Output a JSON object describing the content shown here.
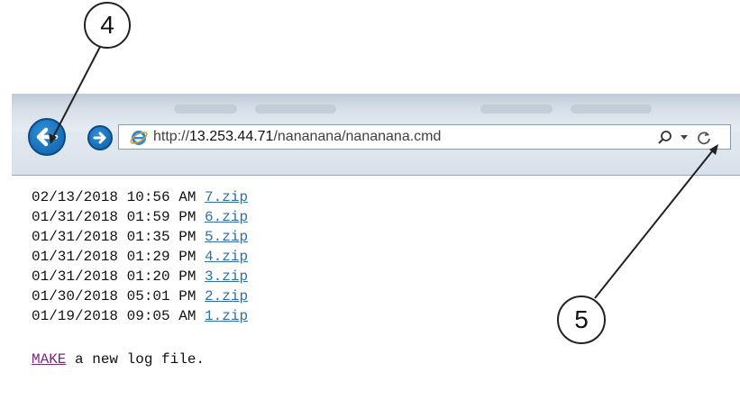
{
  "callouts": {
    "back_label": "4",
    "refresh_label": "5"
  },
  "browser": {
    "address_bar": {
      "url_prefix": "http://",
      "url_host": "13.253.44.71",
      "url_path": "/nananana/nananana.cmd"
    },
    "icons": {
      "back": "back-arrow-icon",
      "forward": "forward-arrow-icon",
      "site": "internet-explorer-icon",
      "search": "search-icon",
      "dropdown": "chevron-down-icon",
      "refresh": "refresh-icon"
    },
    "accent_color": "#1a73c0"
  },
  "listing": [
    {
      "date": "02/13/2018",
      "time": "10:56 AM",
      "file": "7.zip"
    },
    {
      "date": "01/31/2018",
      "time": "01:59 PM",
      "file": "6.zip"
    },
    {
      "date": "01/31/2018",
      "time": "01:35 PM",
      "file": "5.zip"
    },
    {
      "date": "01/31/2018",
      "time": "01:29 PM",
      "file": "4.zip"
    },
    {
      "date": "01/31/2018",
      "time": "01:20 PM",
      "file": "3.zip"
    },
    {
      "date": "01/30/2018",
      "time": "05:01 PM",
      "file": "2.zip"
    },
    {
      "date": "01/19/2018",
      "time": "09:05 AM",
      "file": "1.zip"
    }
  ],
  "footer": {
    "make_link": "MAKE",
    "make_text": " a new log file."
  }
}
